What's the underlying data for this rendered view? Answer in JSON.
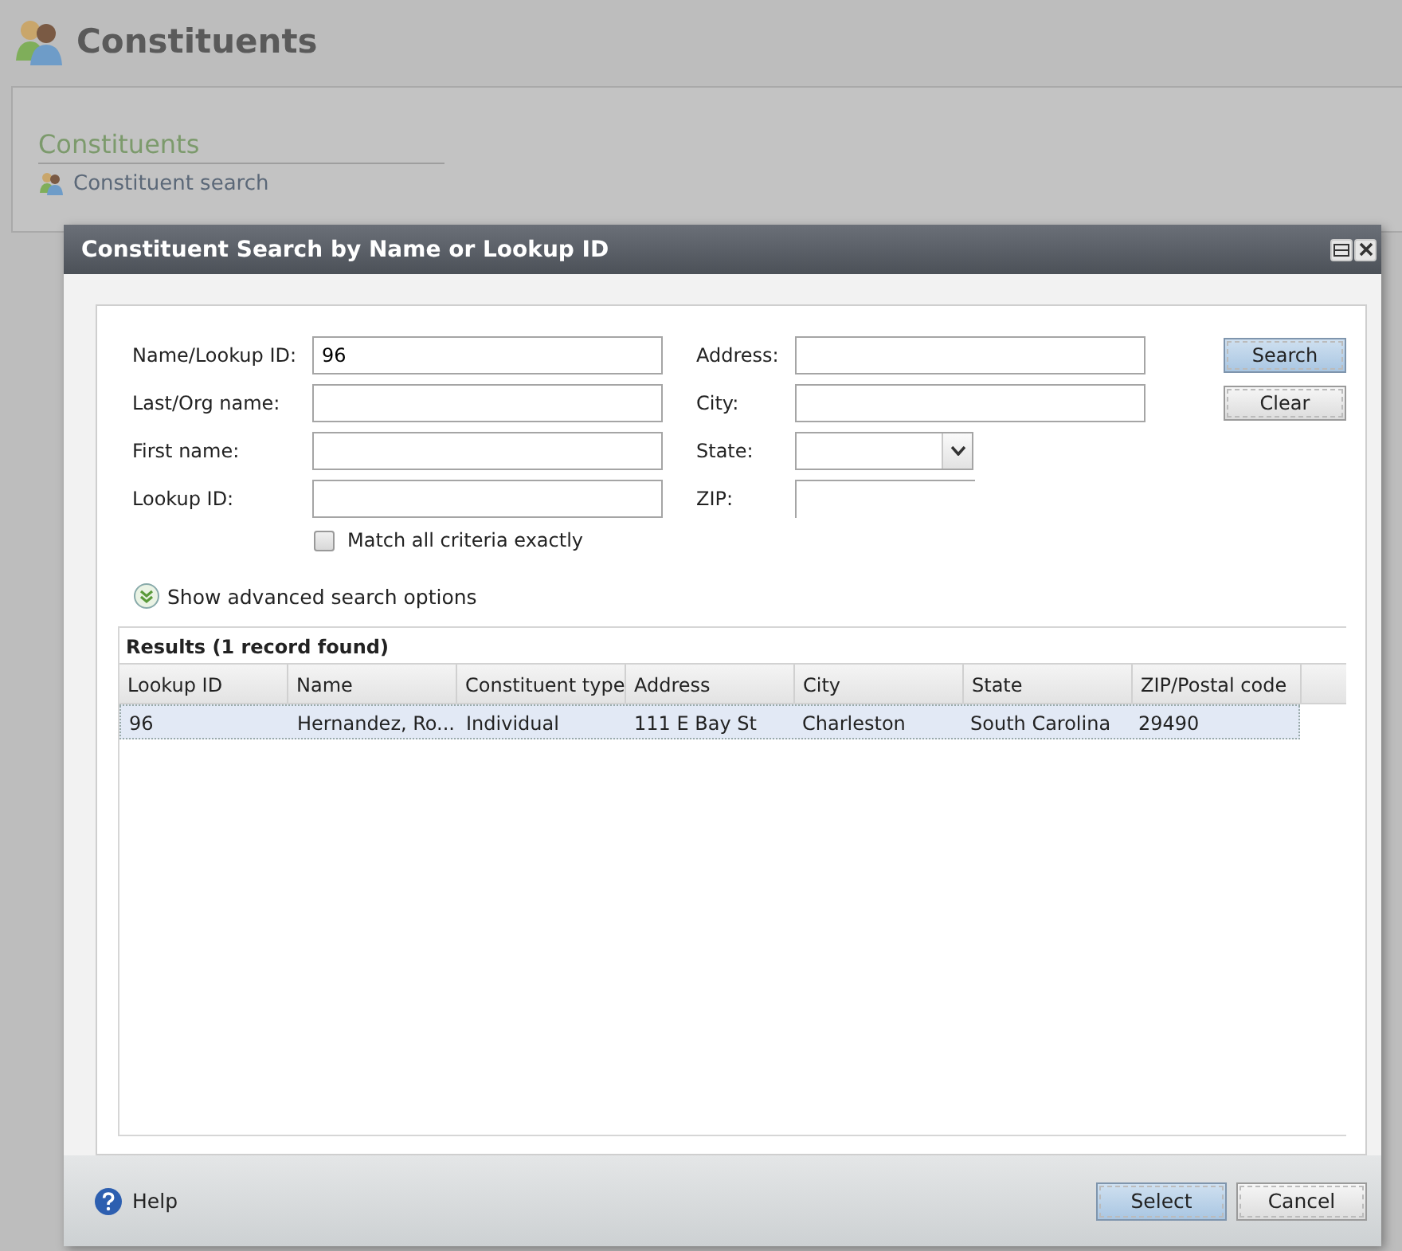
{
  "page": {
    "title": "Constituents"
  },
  "panel": {
    "heading": "Constituents",
    "links": [
      {
        "label": "Constituent search"
      }
    ]
  },
  "dialog": {
    "title": "Constituent Search by Name or Lookup ID",
    "fields_left": [
      {
        "label": "Name/Lookup ID:",
        "value": "96"
      },
      {
        "label": "Last/Org name:"
      },
      {
        "label": "First name:"
      },
      {
        "label": "Lookup ID:"
      }
    ],
    "fields_right": [
      {
        "label": "Address:",
        "kind": "text"
      },
      {
        "label": "City:",
        "kind": "text"
      },
      {
        "label": "State:",
        "kind": "dropdown"
      },
      {
        "label": "ZIP:",
        "kind": "partial"
      }
    ],
    "match_exactly": {
      "label": "Match all criteria exactly",
      "checked": false
    },
    "advanced_link": "Show advanced search options",
    "buttons": [
      {
        "label": "Search",
        "default": true
      },
      {
        "label": "Clear",
        "default": false
      }
    ],
    "results": {
      "title": "Results (1 record found)",
      "columns": [
        "Lookup ID",
        "Name",
        "Constituent type",
        "Address",
        "City",
        "State",
        "ZIP/Postal code"
      ],
      "rows": [
        {
          "selected": true,
          "cells": [
            "96",
            "Hernandez, Ro...",
            "Individual",
            "111 E Bay St",
            "Charleston",
            "South Carolina",
            "29490"
          ]
        }
      ]
    },
    "help": "Help",
    "footer_buttons": [
      {
        "label": "Select",
        "default": true
      },
      {
        "label": "Cancel",
        "default": false
      }
    ]
  }
}
